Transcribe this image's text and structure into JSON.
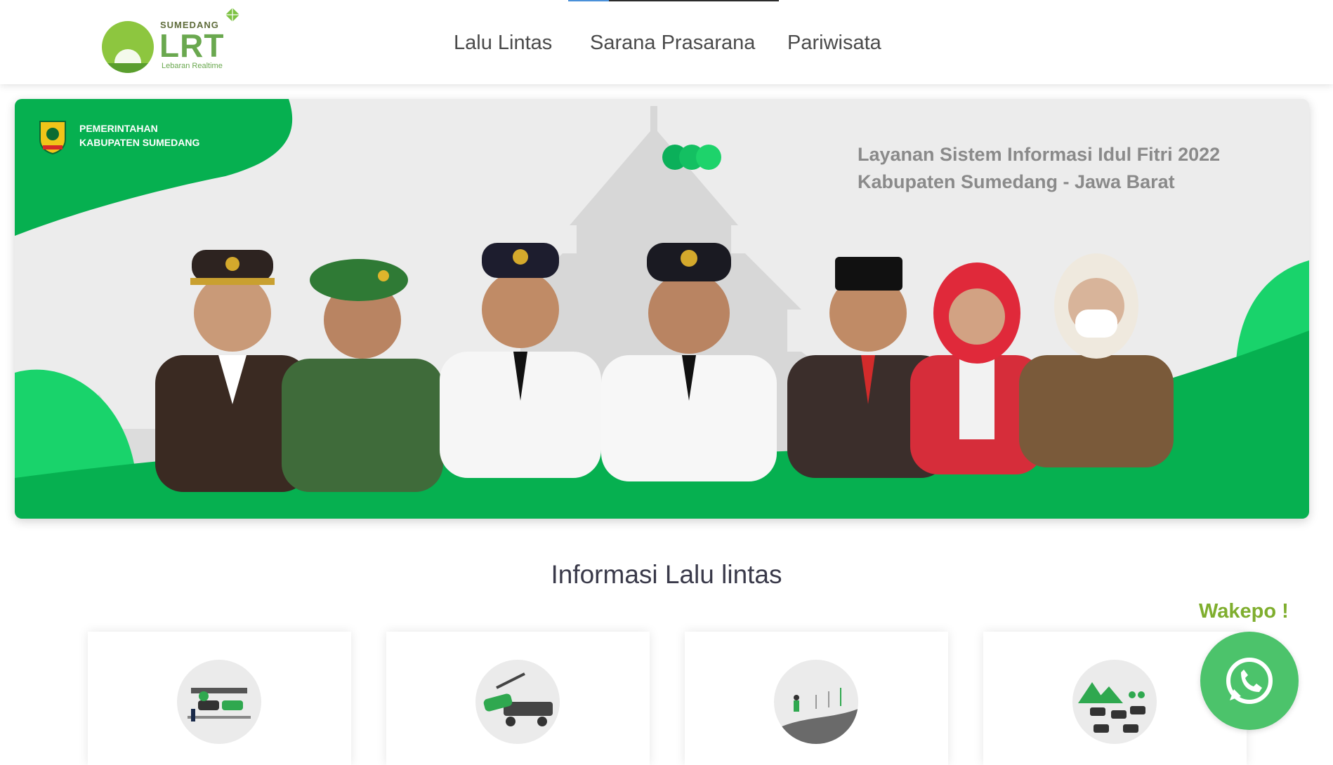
{
  "header": {
    "logo": {
      "top_text": "SUMEDANG",
      "main_text": "LRT",
      "sub_text": "Lebaran Realtime"
    },
    "nav": [
      {
        "label": "Lalu Lintas"
      },
      {
        "label": "Sarana Prasarana"
      },
      {
        "label": "Pariwisata"
      }
    ]
  },
  "banner": {
    "gov_label_line1": "PEMERINTAHAN",
    "gov_label_line2": "KABUPATEN SUMEDANG",
    "title_line1": "Layanan Sistem Informasi Idul Fitri 2022",
    "title_line2": "Kabupaten Sumedang - Jawa Barat",
    "colors": {
      "green": "#06b050",
      "light_green": "#19d36b",
      "bg": "#ececec"
    }
  },
  "section": {
    "title": "Informasi Lalu lintas"
  },
  "cards": [
    {
      "icon": "traffic-jam-icon"
    },
    {
      "icon": "tow-truck-icon"
    },
    {
      "icon": "road-walker-icon"
    },
    {
      "icon": "highway-cars-icon"
    }
  ],
  "whatsapp": {
    "label": "Wakepo !",
    "icon": "whatsapp-icon",
    "color": "#4cc36b"
  }
}
